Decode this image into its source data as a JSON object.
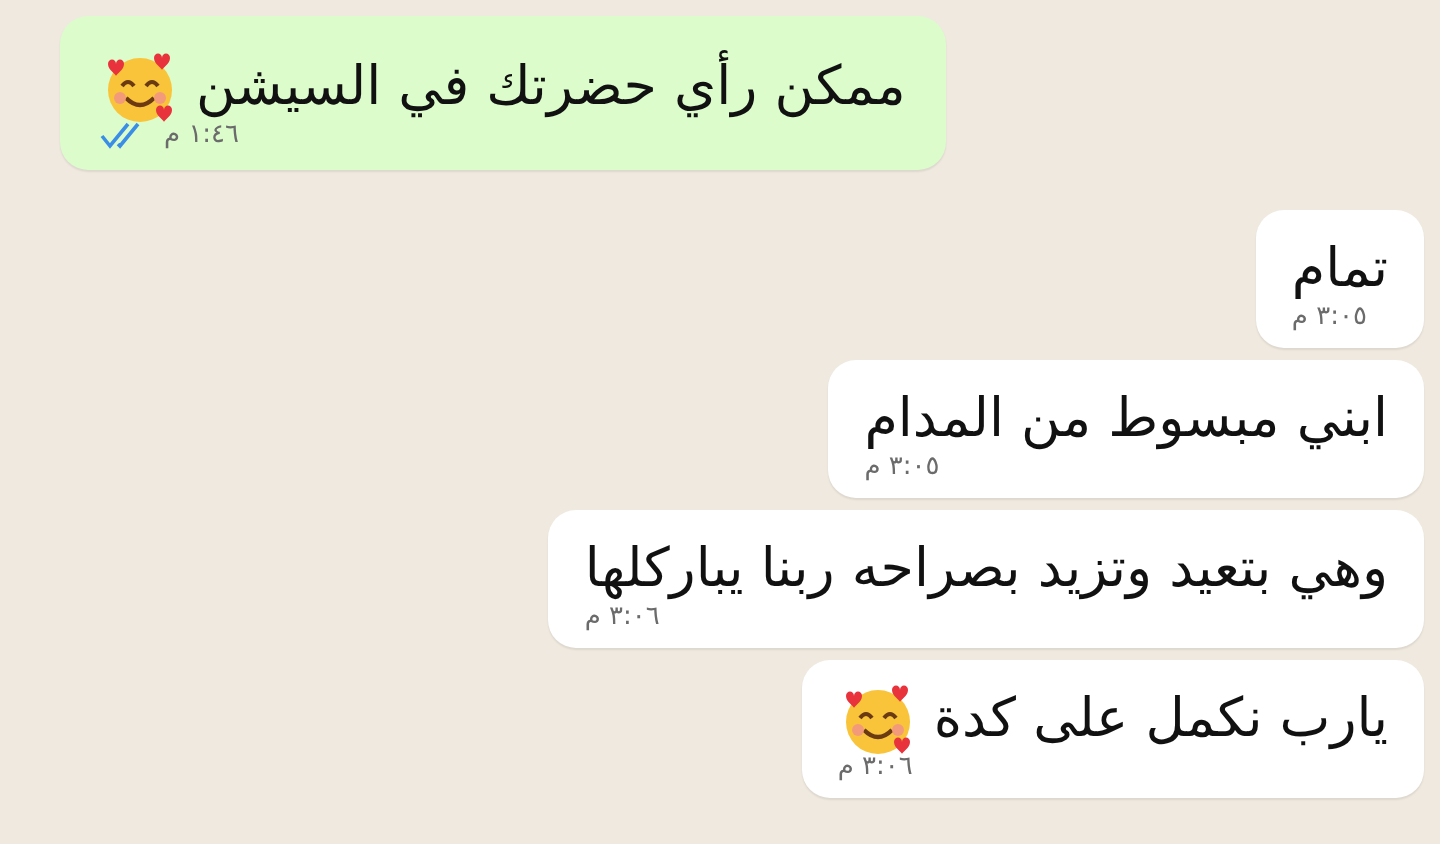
{
  "messages": [
    {
      "kind": "sent",
      "text": "ممكن رأي حضرتك في السيشن",
      "emoji": true,
      "time": "١:٤٦ م",
      "read": true
    },
    {
      "kind": "received",
      "text": "تمام",
      "emoji": false,
      "time": "٣:٠٥ م"
    },
    {
      "kind": "received",
      "text": "ابني مبسوط من المدام",
      "emoji": false,
      "time": "٣:٠٥ م"
    },
    {
      "kind": "received",
      "text": "وهي بتعيد وتزيد بصراحه ربنا يباركلها",
      "emoji": false,
      "time": "٣:٠٦ م"
    },
    {
      "kind": "received",
      "text": "يارب نكمل على كدة",
      "emoji": true,
      "time": "٣:٠٦ م"
    }
  ]
}
